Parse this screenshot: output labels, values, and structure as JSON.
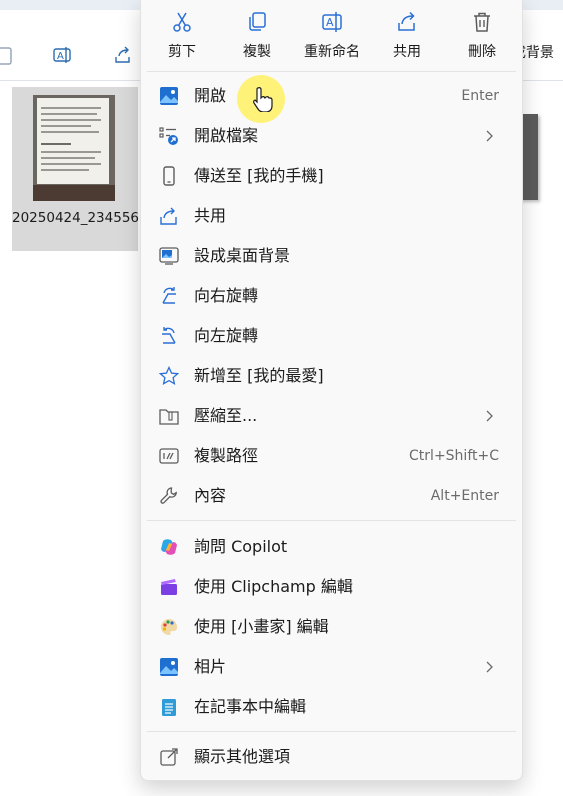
{
  "background": {
    "toolbar_partial_label": "成背景",
    "file": {
      "name": "20250424_234556"
    }
  },
  "menu": {
    "quick_actions": [
      {
        "label": "剪下",
        "icon": "cut-icon"
      },
      {
        "label": "複製",
        "icon": "copy-icon"
      },
      {
        "label": "重新命名",
        "icon": "rename-icon"
      },
      {
        "label": "共用",
        "icon": "share-icon"
      },
      {
        "label": "刪除",
        "icon": "delete-icon"
      }
    ],
    "items": [
      {
        "label": "開啟",
        "shortcut": "Enter",
        "icon": "photo-icon"
      },
      {
        "label": "開啟檔案",
        "shortcut": "",
        "icon": "open-with-icon",
        "submenu": true
      },
      {
        "label": "傳送至 [我的手機]",
        "shortcut": "",
        "icon": "phone-icon"
      },
      {
        "label": "共用",
        "shortcut": "",
        "icon": "share-icon"
      },
      {
        "label": "設成桌面背景",
        "shortcut": "",
        "icon": "desktop-background-icon"
      },
      {
        "label": "向右旋轉",
        "shortcut": "",
        "icon": "rotate-right-icon"
      },
      {
        "label": "向左旋轉",
        "shortcut": "",
        "icon": "rotate-left-icon"
      },
      {
        "label": "新增至 [我的最愛]",
        "shortcut": "",
        "icon": "star-icon"
      },
      {
        "label": "壓縮至...",
        "shortcut": "",
        "icon": "zip-folder-icon",
        "submenu": true
      },
      {
        "label": "複製路徑",
        "shortcut": "Ctrl+Shift+C",
        "icon": "copy-path-icon"
      },
      {
        "label": "內容",
        "shortcut": "Alt+Enter",
        "icon": "wrench-icon"
      }
    ],
    "app_items": [
      {
        "label": "詢問 Copilot",
        "icon": "copilot-icon"
      },
      {
        "label": "使用 Clipchamp 編輯",
        "icon": "clipchamp-icon"
      },
      {
        "label": "使用 [小畫家] 編輯",
        "icon": "paint-icon"
      },
      {
        "label": "相片",
        "icon": "photos-icon",
        "submenu": true
      },
      {
        "label": "在記事本中編輯",
        "icon": "notepad-icon"
      }
    ],
    "more_options": {
      "label": "顯示其他選項",
      "icon": "more-options-icon"
    }
  },
  "colors": {
    "accent": "#2a6fd6",
    "menu_bg": "#f9f9f9",
    "cursor_highlight": "#fff16a"
  }
}
